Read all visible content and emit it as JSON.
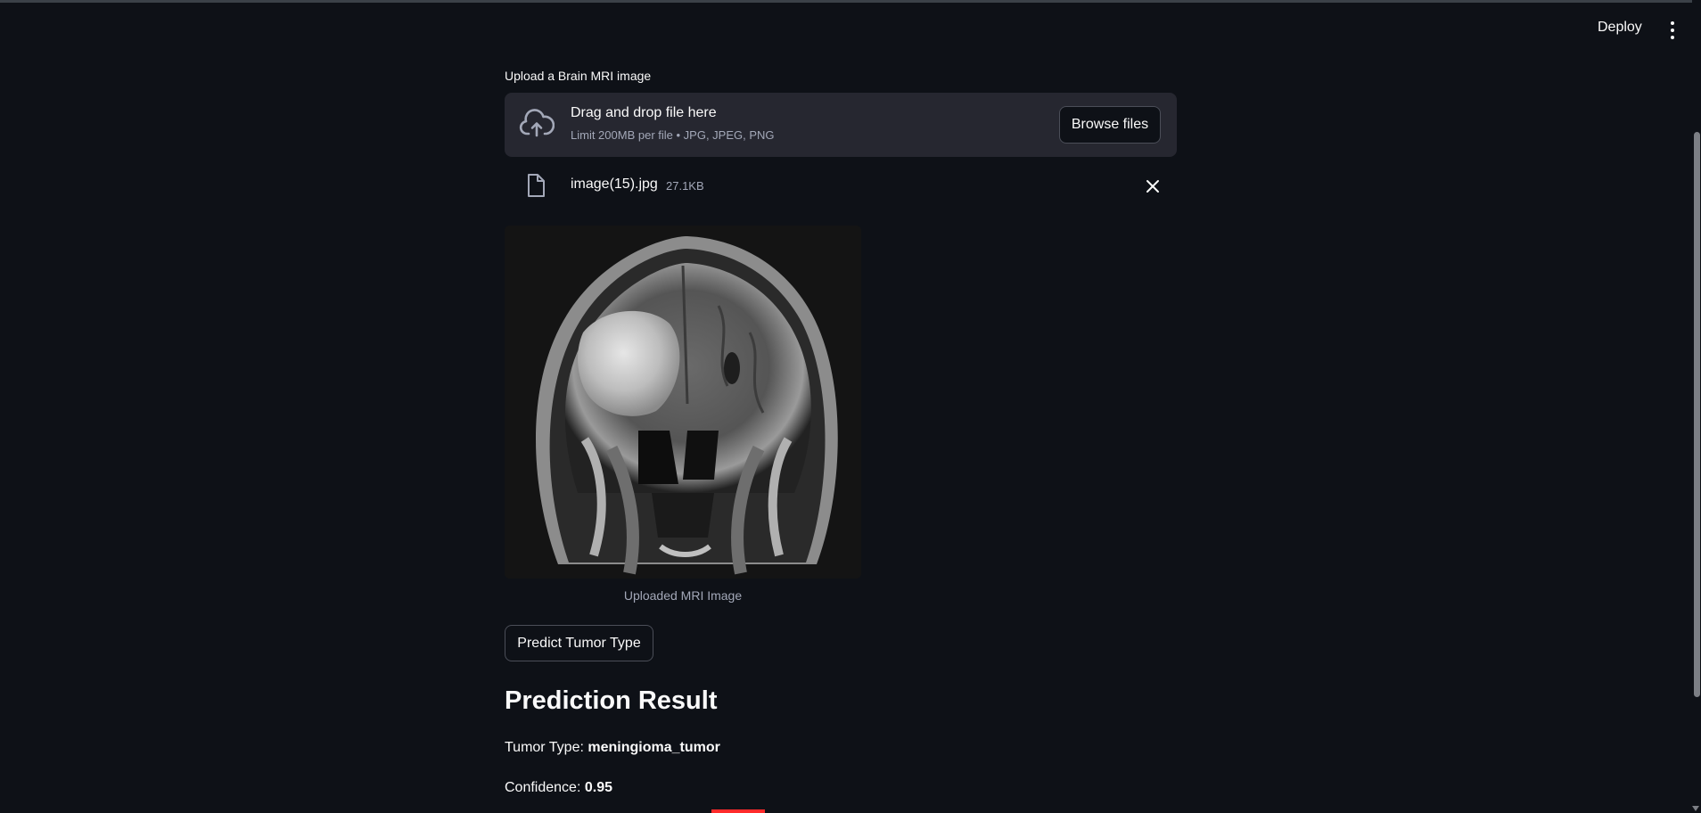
{
  "header": {
    "deploy_label": "Deploy",
    "menu_icon": "kebab-menu-icon"
  },
  "uploader": {
    "label": "Upload a Brain MRI image",
    "dropzone_title": "Drag and drop file here",
    "dropzone_limit": "Limit 200MB per file • JPG, JPEG, PNG",
    "browse_label": "Browse files",
    "upload_icon": "cloud-upload-icon"
  },
  "file": {
    "name": "image(15).jpg",
    "size": "27.1KB",
    "file_icon": "file-icon",
    "remove_icon": "close-icon"
  },
  "image": {
    "caption": "Uploaded MRI Image"
  },
  "actions": {
    "predict_label": "Predict Tumor Type"
  },
  "result": {
    "title": "Prediction Result",
    "tumor_type_label": "Tumor Type:",
    "tumor_type_value": "meningioma_tumor",
    "confidence_label": "Confidence:",
    "confidence_value": "0.95"
  },
  "colors": {
    "background": "#0e1117",
    "dropzone": "#262730",
    "muted_text": "#a3a8b8",
    "accent_red": "#ff2b2b"
  }
}
